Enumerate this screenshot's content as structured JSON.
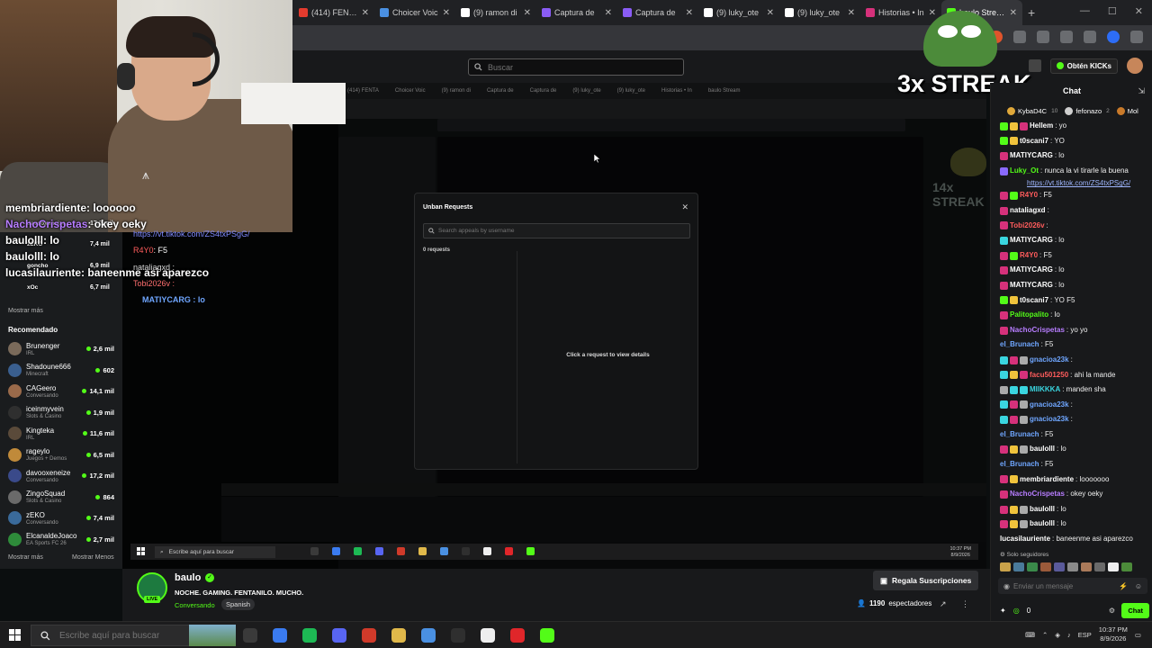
{
  "browser": {
    "tabs": [
      {
        "title": "(414) FENTA",
        "color": "#e33b2e"
      },
      {
        "title": "Choicer Voic",
        "color": "#4a90e2"
      },
      {
        "title": "(9) ramon di",
        "color": "#ffffff"
      },
      {
        "title": "Captura de",
        "color": "#8a5cf5"
      },
      {
        "title": "Captura de",
        "color": "#8a5cf5"
      },
      {
        "title": "(9) luky_ote",
        "color": "#ffffff"
      },
      {
        "title": "(9) luky_ote",
        "color": "#ffffff"
      },
      {
        "title": "Historias • In",
        "color": "#d6317b"
      },
      {
        "title": "baulo Stream",
        "color": "#53fc18"
      }
    ]
  },
  "kick": {
    "search_placeholder": "Buscar",
    "get_kicks_label": "Obtén KICKs"
  },
  "sidebar": {
    "show_more_label": "Mostrar más",
    "recommended_title": "Recomendado",
    "recommended": [
      {
        "name": "Brunenger",
        "category": "IRL",
        "viewers": "2,6 mil",
        "color": "#7a6a5a"
      },
      {
        "name": "Shadoune666",
        "category": "Minecraft",
        "viewers": "602",
        "color": "#3a5f8f"
      },
      {
        "name": "CAGeero",
        "category": "Conversando",
        "viewers": "14,1 mil",
        "color": "#9a6a4a"
      },
      {
        "name": "iceinmyvein",
        "category": "Slots & Casino",
        "viewers": "1,9 mil",
        "color": "#2f2f2f"
      },
      {
        "name": "Kingteka",
        "category": "IRL",
        "viewers": "11,6 mil",
        "color": "#5a4a3a"
      },
      {
        "name": "rageylo",
        "category": "Juegos + Demos",
        "viewers": "6,5 mil",
        "color": "#c08a3a"
      },
      {
        "name": "davooxeneize",
        "category": "Conversando",
        "viewers": "17,2 mil",
        "color": "#3a4a8a"
      },
      {
        "name": "ZingoSquad",
        "category": "Slots & Casino",
        "viewers": "864",
        "color": "#6a6a6a"
      },
      {
        "name": "zEKO",
        "category": "Conversando",
        "viewers": "7,4 mil",
        "color": "#3a6a9a"
      },
      {
        "name": "ElcanaldeJoaco",
        "category": "EA Sports FC 26",
        "viewers": "2,7 mil",
        "color": "#2e8b3a"
      }
    ],
    "show_more_bottom": "Mostrar más",
    "show_less": "Mostrar Menos"
  },
  "overlay": {
    "lines": [
      {
        "user": "membriardiente",
        "text": ": loooooo",
        "color": "#ffffff"
      },
      {
        "user": "NachoCrispetas",
        "text": ": okey oeky",
        "color": "#b77dff"
      },
      {
        "user": "baulolll",
        "text": ": lo",
        "color": "#ffffff"
      },
      {
        "user": "baulolll",
        "text": ": lo",
        "color": "#ffffff"
      },
      {
        "user": "lucasilauriente",
        "text": ": baneenme asi aparezco",
        "color": "#ffffff"
      }
    ],
    "side_labels": [
      {
        "name": "davooxeneize",
        "count": "17,2 mil"
      },
      {
        "name": "zEKO",
        "count": "7,4 mil"
      },
      {
        "name": "goncho",
        "count": "6,9 mil"
      },
      {
        "name": "xOc",
        "count": "6,7 mil"
      }
    ],
    "link": "https://vt.tiktok.com/ZS4txPSgG/",
    "r4y0_user": "R4Y0",
    "r4y0_text": ": F5",
    "natalia": "nataliagxd :",
    "tobi": "Tobi2026v :",
    "mati": "MATIYCARG : lo",
    "streak_big": "3x STREAK",
    "streak_small": "14x STREAK"
  },
  "modal": {
    "title": "Unban Requests",
    "search_placeholder": "Search appeals by username",
    "count": "0 requests",
    "hint": "Click a request to view details"
  },
  "chat": {
    "title": "Chat",
    "leaders": [
      {
        "name": "KybaD4C",
        "rank": "10",
        "color": "#e0a83a"
      },
      {
        "name": "fefonazo",
        "rank": "2",
        "color": "#cfcfcf"
      },
      {
        "name": "Mol",
        "rank": "",
        "color": "#c97a2a"
      }
    ],
    "messages": [
      {
        "user": "Hellem",
        "text": ": yo",
        "ucolor": "#ffffff",
        "badges": [
          "#53fc18",
          "#f0c33c",
          "#d6317b"
        ]
      },
      {
        "user": "t0scani7",
        "text": ": YO",
        "ucolor": "#ffffff",
        "badges": [
          "#53fc18",
          "#f0c33c"
        ]
      },
      {
        "user": "MATIYCARG",
        "text": ": lo",
        "ucolor": "#ffffff",
        "badges": [
          "#d6317b"
        ]
      },
      {
        "user": "Luky_Ot",
        "text": ": nunca la vi tirarle la buena",
        "ucolor": "#53fc18",
        "link": "https://vt.tiktok.com/ZS4txPSgG/",
        "badges": [
          "#8a6aff"
        ]
      },
      {
        "user": "R4Y0",
        "text": ": F5",
        "ucolor": "#ff5c5c",
        "badges": [
          "#d6317b",
          "#53fc18"
        ]
      },
      {
        "user": "nataliagxd",
        "text": ":",
        "ucolor": "#ffffff",
        "badges": [
          "#d6317b"
        ]
      },
      {
        "user": "Tobi2026v",
        "text": ":",
        "ucolor": "#ff5c5c",
        "badges": [
          "#d6317b"
        ]
      },
      {
        "user": "MATIYCARG",
        "text": ": lo",
        "ucolor": "#ffffff",
        "badges": [
          "#3ad6e0"
        ]
      },
      {
        "user": "R4Y0",
        "text": ": F5",
        "ucolor": "#ff5c5c",
        "badges": [
          "#d6317b",
          "#53fc18"
        ]
      },
      {
        "user": "MATIYCARG",
        "text": ": lo",
        "ucolor": "#ffffff",
        "badges": [
          "#d6317b"
        ]
      },
      {
        "user": "MATIYCARG",
        "text": ": lo",
        "ucolor": "#ffffff",
        "badges": [
          "#d6317b"
        ]
      },
      {
        "user": "t0scani7",
        "text": ": YO F5",
        "ucolor": "#ffffff",
        "badges": [
          "#53fc18",
          "#f0c33c"
        ]
      },
      {
        "user": "Palitopalito",
        "text": ": lo",
        "ucolor": "#53fc18",
        "badges": [
          "#d6317b"
        ]
      },
      {
        "user": "NachoCrispetas",
        "text": ": yo yo",
        "ucolor": "#b77dff",
        "badges": [
          "#d6317b"
        ]
      },
      {
        "user": "el_Brunach",
        "text": ": F5",
        "ucolor": "#6fa6ff",
        "badges": []
      },
      {
        "user": "gnacioa23k",
        "text": ":",
        "ucolor": "#6fa6ff",
        "badges": [
          "#3ad6e0",
          "#d6317b",
          "#aaaaaa"
        ]
      },
      {
        "user": "facu501250",
        "text": ": ahi la mande",
        "ucolor": "#ff5c5c",
        "badges": [
          "#3ad6e0",
          "#f0c33c",
          "#d6317b"
        ]
      },
      {
        "user": "MIIKKKA",
        "text": ": manden sha",
        "ucolor": "#3ad6e0",
        "badges": [
          "#aaaaaa",
          "#3ad6e0",
          "#3ad6e0"
        ]
      },
      {
        "user": "gnacioa23k",
        "text": ":",
        "ucolor": "#6fa6ff",
        "badges": [
          "#3ad6e0",
          "#d6317b",
          "#aaaaaa"
        ]
      },
      {
        "user": "gnacioa23k",
        "text": ":",
        "ucolor": "#6fa6ff",
        "badges": [
          "#3ad6e0",
          "#d6317b",
          "#aaaaaa"
        ]
      },
      {
        "user": "el_Brunach",
        "text": ": F5",
        "ucolor": "#6fa6ff",
        "badges": []
      },
      {
        "user": "baulolll",
        "text": ": lo",
        "ucolor": "#ffffff",
        "badges": [
          "#d6317b",
          "#f0c33c",
          "#aaaaaa"
        ]
      },
      {
        "user": "el_Brunach",
        "text": ": F5",
        "ucolor": "#6fa6ff",
        "badges": []
      },
      {
        "user": "membriardiente",
        "text": ": looooooo",
        "ucolor": "#ffffff",
        "badges": [
          "#d6317b",
          "#f0c33c"
        ]
      },
      {
        "user": "NachoCrispetas",
        "text": ": okey oeky",
        "ucolor": "#b77dff",
        "badges": [
          "#d6317b"
        ]
      },
      {
        "user": "baulolll",
        "text": ": lo",
        "ucolor": "#ffffff",
        "badges": [
          "#d6317b",
          "#f0c33c",
          "#aaaaaa"
        ]
      },
      {
        "user": "baulolll",
        "text": ": lo",
        "ucolor": "#ffffff",
        "badges": [
          "#d6317b",
          "#f0c33c",
          "#aaaaaa"
        ]
      },
      {
        "user": "lucasilauriente",
        "text": ": baneenme asi aparezco",
        "ucolor": "#ffffff",
        "badges": []
      }
    ],
    "followers_only": "Solo seguidores",
    "input_placeholder": "Enviar un mensaje",
    "points": "0",
    "send_label": "Chat"
  },
  "channel": {
    "name": "baulo",
    "live_label": "LIVE",
    "title": "NOCHE. GAMING. FENTANILO. MUCHO.",
    "category": "Conversando",
    "language": "Spanish",
    "gift_label": "Regala Suscripciones",
    "viewers": "1190",
    "viewers_label": "espectadores"
  },
  "taskbar": {
    "search_placeholder": "Escribe aquí para buscar",
    "lang": "ESP",
    "time": "10:37 PM",
    "date": "8/9/2026",
    "apps": [
      {
        "name": "task-view",
        "color": "#3a3a3a"
      },
      {
        "name": "copilot",
        "color": "#3a7bf0"
      },
      {
        "name": "spotify",
        "color": "#1db954"
      },
      {
        "name": "discord",
        "color": "#5865f2"
      },
      {
        "name": "voice-app",
        "color": "#d03a2a"
      },
      {
        "name": "file-explorer",
        "color": "#e0b84a"
      },
      {
        "name": "chrome",
        "color": "#4a90e2"
      },
      {
        "name": "obs",
        "color": "#2f2f2f"
      },
      {
        "name": "capcut",
        "color": "#eeeeee"
      },
      {
        "name": "opera",
        "color": "#e0262a"
      },
      {
        "name": "kick",
        "color": "#53fc18"
      }
    ]
  },
  "inner": {
    "search_text": "Escribe aquí para buscar",
    "time": "10:37 PM",
    "date": "8/9/2026"
  }
}
